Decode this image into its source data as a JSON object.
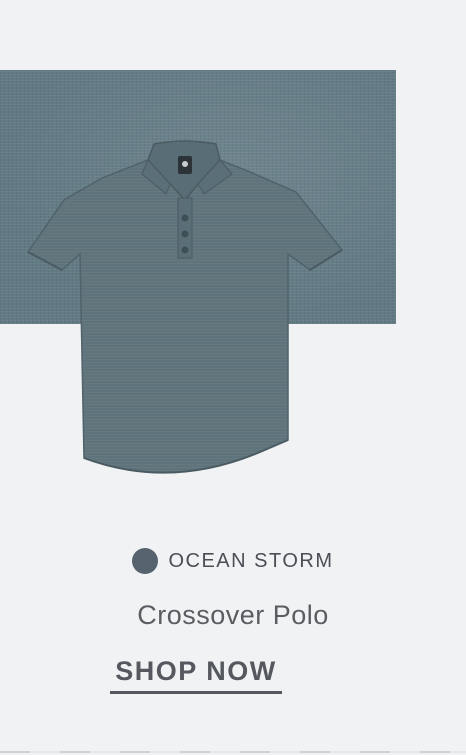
{
  "product": {
    "color_name": "OCEAN STORM",
    "swatch_color": "#56636f",
    "name": "Crossover Polo",
    "cta_label": "SHOP NOW"
  },
  "colors": {
    "background": "#f1f2f4",
    "fabric": "#627a84",
    "shirt": "#5f737c",
    "text": "#55595f"
  },
  "icons": [
    "collar-logo-icon"
  ]
}
